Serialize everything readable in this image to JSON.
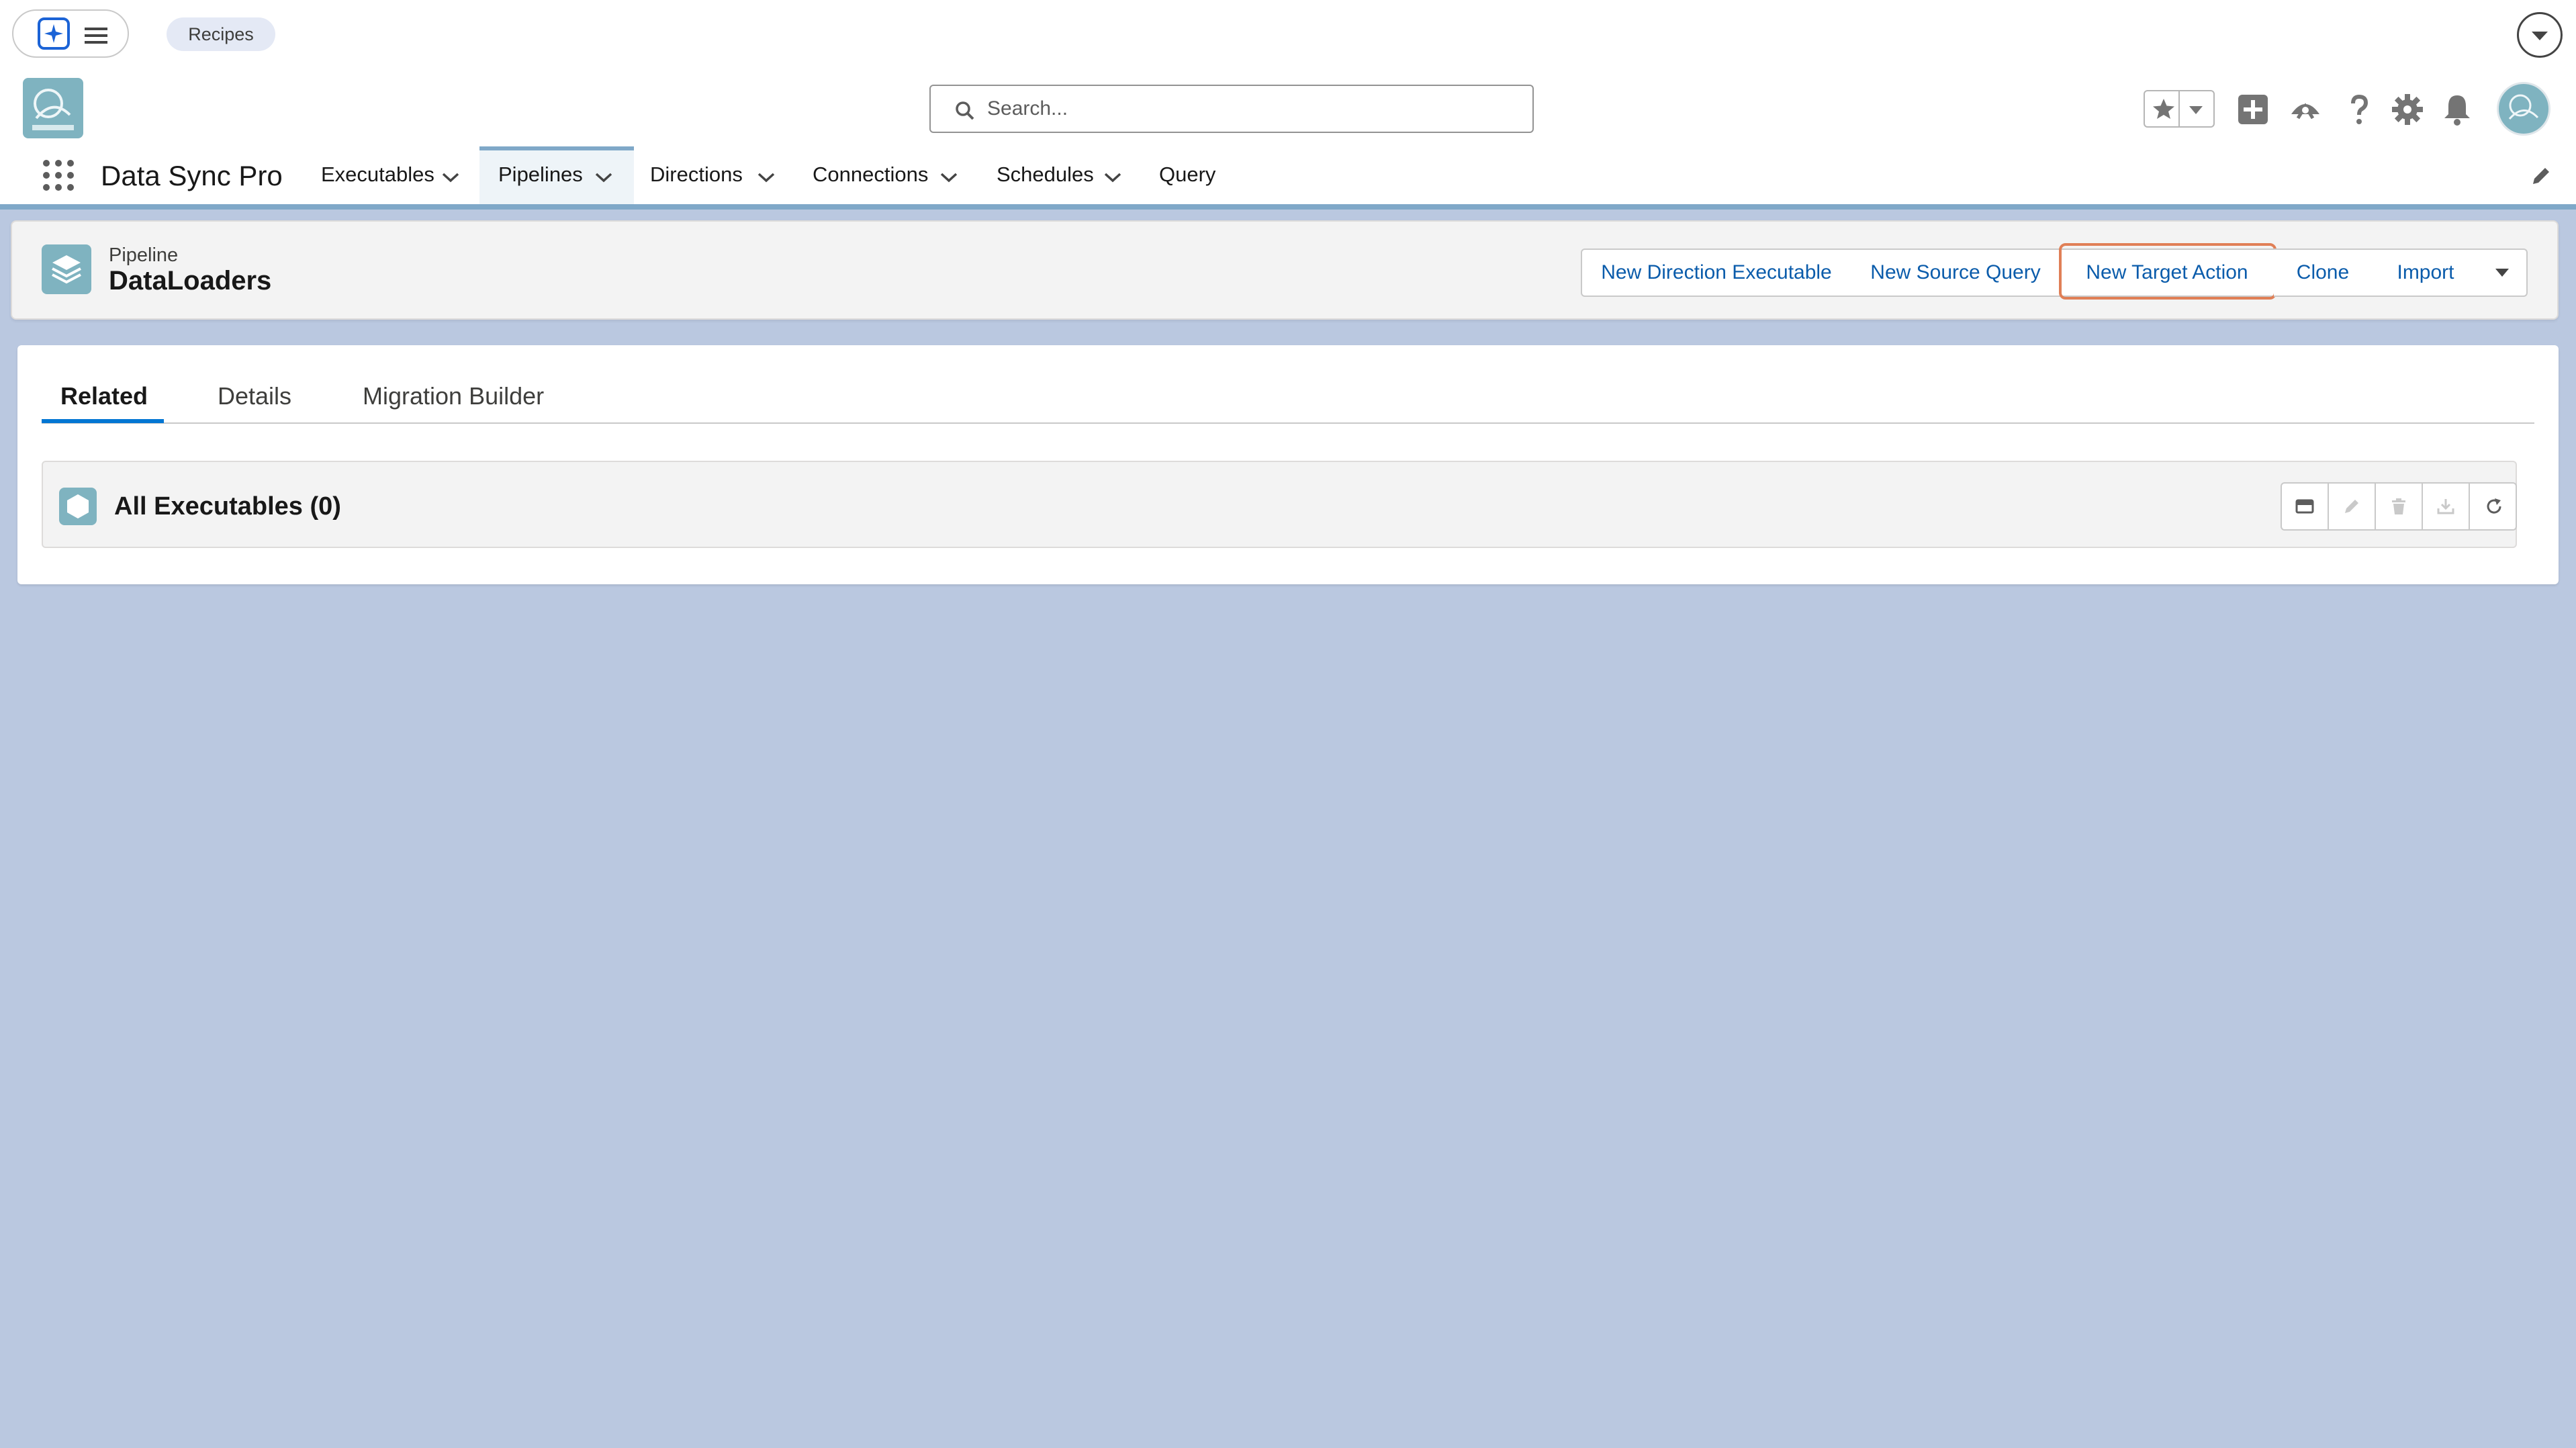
{
  "utility_bar": {
    "chip_label": "Recipes"
  },
  "header": {
    "search_placeholder": "Search..."
  },
  "nav": {
    "app_name": "Data Sync Pro",
    "items": [
      {
        "label": "Executables",
        "has_menu": true
      },
      {
        "label": "Pipelines",
        "has_menu": true,
        "active": true
      },
      {
        "label": "Directions",
        "has_menu": true
      },
      {
        "label": "Connections",
        "has_menu": true
      },
      {
        "label": "Schedules",
        "has_menu": true
      },
      {
        "label": "Query",
        "has_menu": false
      }
    ]
  },
  "record": {
    "object_label": "Pipeline",
    "name": "DataLoaders",
    "actions": [
      "New Direction Executable",
      "New Source Query",
      "New Target Action",
      "Clone",
      "Import"
    ],
    "highlighted_action": "New Target Action"
  },
  "tabs": {
    "items": [
      "Related",
      "Details",
      "Migration Builder"
    ],
    "active": "Related"
  },
  "related_list": {
    "title": "All Executables (0)",
    "actions": [
      "card-view-icon",
      "edit-icon",
      "delete-icon",
      "download-icon",
      "refresh-icon"
    ]
  },
  "colors": {
    "page_background": "#bac8e0",
    "brand_teal": "#7fb3c0",
    "link_blue": "#0b5cab",
    "active_tab_underline": "#0176d3",
    "highlight_ring": "#e07f56"
  }
}
